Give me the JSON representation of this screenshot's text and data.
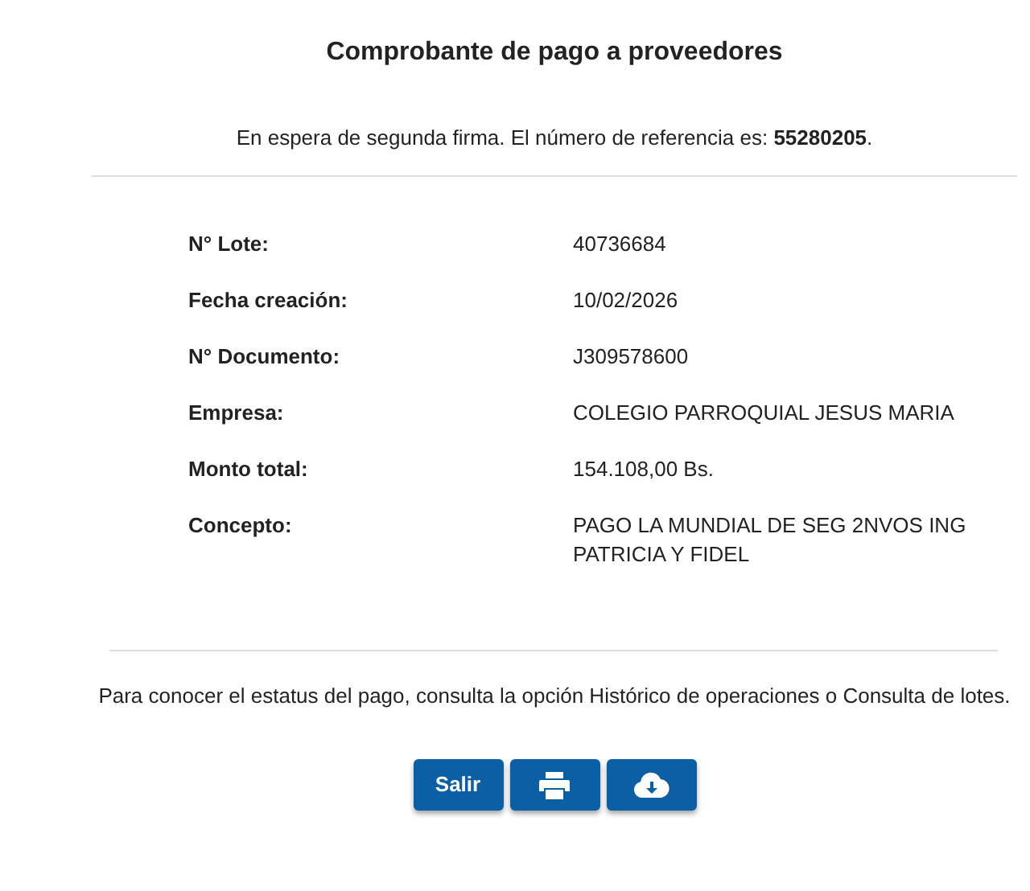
{
  "title": "Comprobante de pago a proveedores",
  "status_message": "En espera de segunda firma. El número de referencia es: **55280205**.",
  "details": [
    {
      "label": "N° Lote:",
      "value": "40736684"
    },
    {
      "label": "Fecha creación:",
      "value": "10/02/2026"
    },
    {
      "label": "N° Documento:",
      "value": "J309578600"
    },
    {
      "label": "Empresa:",
      "value": "COLEGIO PARROQUIAL JESUS MARIA"
    },
    {
      "label": "Monto total:",
      "value": "154.108,00 Bs."
    },
    {
      "label": "Concepto:",
      "value": "PAGO LA MUNDIAL DE SEG 2NVOS ING PATRICIA Y FIDEL"
    }
  ],
  "footer_note": "Para conocer el estatus del pago, consulta la opción Histórico de operaciones o Consulta de lotes.",
  "buttons": [
    {
      "kind": "text",
      "label": "Salir"
    },
    {
      "kind": "print"
    },
    {
      "kind": "download"
    }
  ]
}
